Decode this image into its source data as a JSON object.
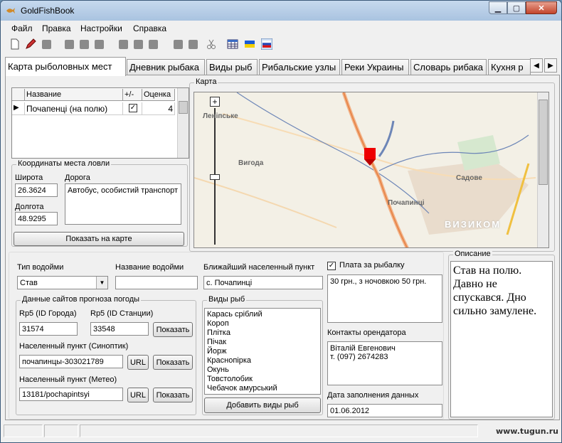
{
  "window": {
    "title": "GoldFishBook"
  },
  "menu": [
    "Файл",
    "Правка",
    "Настройки",
    "Справка"
  ],
  "tabs": [
    "Карта рыболовных мест",
    "Дневник рыбака",
    "Виды рыб",
    "Рибальские узлы",
    "Реки Украины",
    "Словарь рибака",
    "Кухня р"
  ],
  "grid": {
    "columns": [
      "Название",
      "+/-",
      "Оценка"
    ],
    "rows": [
      {
        "name": "Почапенці (на полю)",
        "checked": true,
        "rating": "4"
      }
    ]
  },
  "coords": {
    "group_title": "Координаты места ловли",
    "lat_label": "Широта",
    "lat": "26.3624",
    "lon_label": "Долгота",
    "lon": "48.9295",
    "road_label": "Дорога",
    "road": "Автобус, особистий транспорт",
    "show_button": "Показать на карте"
  },
  "map": {
    "group_title": "Карта",
    "places": [
      "Леніпське",
      "Вигода",
      "Садове",
      "Почапинці"
    ],
    "brand": "ВИЗИКОМ",
    "zoom_plus": "+"
  },
  "water": {
    "type_label": "Тип водойми",
    "type_value": "Став",
    "name_label": "Название водойми",
    "name_value": "",
    "settlement_label": "Ближайший населенный пункт",
    "settlement_value": "с. Почапинці"
  },
  "fee": {
    "label": "Плата за рыбалку",
    "checked": true,
    "value": "30 грн., з ночовкою 50 грн."
  },
  "weather": {
    "group_title": "Данные сайтов прогноза погоды",
    "rp5_city_label": "Rp5 (ID Города)",
    "rp5_city": "31574",
    "rp5_station_label": "Rp5 (ID Станции)",
    "rp5_station": "33548",
    "show": "Показать",
    "sinoptik_label": "Населенный пункт (Синоптик)",
    "sinoptik": "почапинцы-303021789",
    "meteo_label": "Населенный пункт (Метео)",
    "meteo": "13181/pochapintsyi",
    "url": "URL"
  },
  "fish": {
    "group_title": "Виды рыб",
    "items": [
      "Карась сріблий",
      "Короп",
      "Плітка",
      "Пічак",
      "Йорж",
      "Краснопірка",
      "Окунь",
      "Товстолобик",
      "Чебачок амурський"
    ],
    "add_button": "Добавить виды рыб"
  },
  "tenant": {
    "label": "Контакты орендатора",
    "value_line1": "Віталій Евгенович",
    "value_line2": "т. (097) 2674283"
  },
  "date": {
    "label": "Дата заполнения данных",
    "value": "01.06.2012"
  },
  "description": {
    "group_title": "Описание",
    "text": "Став на полю. Давно не спускався. Дно сильно замулене."
  },
  "watermark": "www.tugun.ru"
}
